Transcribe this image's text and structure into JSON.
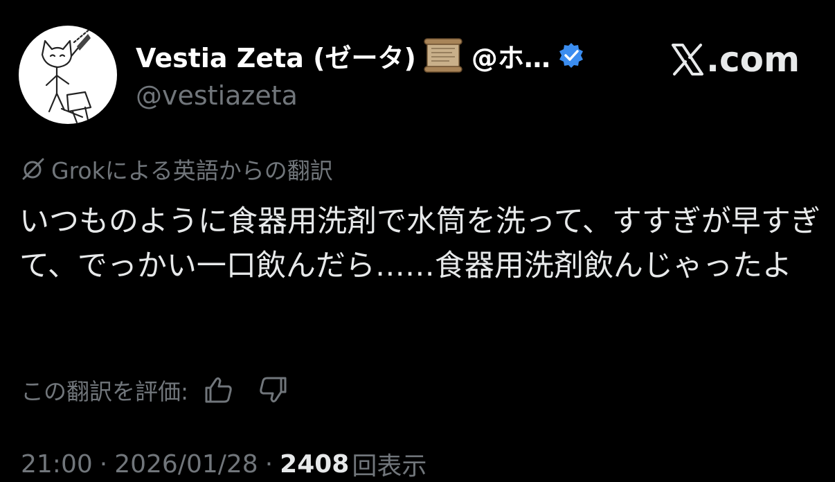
{
  "author": {
    "display_name": "Vestia Zeta (ゼータ)",
    "handle_suffix": "@ホ…",
    "handle": "@vestiazeta",
    "avatar_icon": "cat-sketch-avatar",
    "name_emoji_icon": "scroll-icon",
    "verified_icon": "verified-badge-icon",
    "verified_color": "#3b8df0"
  },
  "brand": {
    "logo_icon": "x-logo-icon",
    "text": ".com"
  },
  "translation": {
    "icon": "grok-icon",
    "label": "Grokによる英語からの翻訳"
  },
  "tweet": {
    "text": "いつものように食器用洗剤で水筒を洗って、すすぎが早すぎて、でっかい一口飲んだら……食器用洗剤飲んじゃったよ"
  },
  "rating": {
    "label": "この翻訳を評価:",
    "thumbs_up_icon": "thumbs-up-icon",
    "thumbs_down_icon": "thumbs-down-icon"
  },
  "meta": {
    "time": "21:00",
    "separator": "·",
    "date": "2026/01/28",
    "views_count": "2408",
    "views_label": "回表示"
  },
  "colors": {
    "background": "#000000",
    "primary_text": "#e7e9ea",
    "secondary_text": "#71767b"
  }
}
